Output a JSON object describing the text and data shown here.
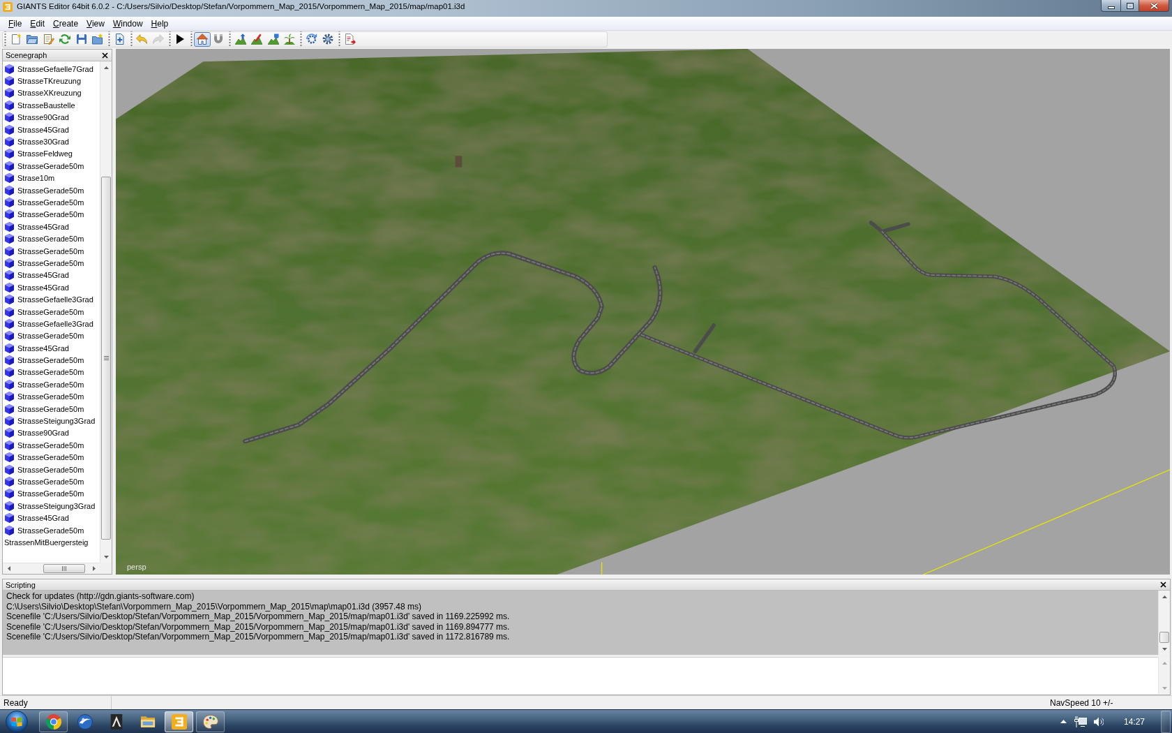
{
  "window": {
    "title": "GIANTS Editor 64bit 6.0.2 - C:/Users/Silvio/Desktop/Stefan/Vorpommern_Map_2015/Vorpommern_Map_2015/map/map01.i3d"
  },
  "menu": [
    "File",
    "Edit",
    "Create",
    "View",
    "Window",
    "Help"
  ],
  "toolbar": {
    "groups": [
      {
        "items": [
          {
            "kind": "new",
            "selected": false,
            "disabled": false
          },
          {
            "kind": "open",
            "selected": false,
            "disabled": false
          },
          {
            "kind": "edit",
            "selected": false,
            "disabled": false
          },
          {
            "kind": "reload",
            "selected": false,
            "disabled": false
          },
          {
            "kind": "save",
            "selected": false,
            "disabled": false
          },
          {
            "kind": "export",
            "selected": false,
            "disabled": false
          }
        ]
      },
      {
        "items": [
          {
            "kind": "import",
            "selected": false,
            "disabled": false
          }
        ]
      },
      {
        "items": [
          {
            "kind": "undo",
            "selected": false,
            "disabled": false
          },
          {
            "kind": "redo",
            "selected": false,
            "disabled": true
          }
        ]
      },
      {
        "items": [
          {
            "kind": "play",
            "selected": false,
            "disabled": false
          }
        ]
      },
      {
        "items": [
          {
            "kind": "home",
            "selected": true,
            "disabled": false
          },
          {
            "kind": "magnet",
            "selected": false,
            "disabled": false
          }
        ]
      },
      {
        "items": [
          {
            "kind": "terrain",
            "selected": false,
            "disabled": false
          },
          {
            "kind": "sculpt",
            "selected": false,
            "disabled": false
          },
          {
            "kind": "paint",
            "selected": false,
            "disabled": false
          },
          {
            "kind": "foliage",
            "selected": false,
            "disabled": false
          }
        ]
      },
      {
        "items": [
          {
            "kind": "sync",
            "selected": false,
            "disabled": false
          },
          {
            "kind": "settings",
            "selected": false,
            "disabled": false
          }
        ]
      },
      {
        "items": [
          {
            "kind": "report",
            "selected": false,
            "disabled": false
          }
        ]
      }
    ]
  },
  "scenegraph": {
    "title": "Scenegraph",
    "items": [
      {
        "label": "StrasseGefaelle7Grad",
        "kind": "shape",
        "selected": false
      },
      {
        "label": "StrasseTKreuzung",
        "kind": "shape",
        "selected": false
      },
      {
        "label": "StrasseXKreuzung",
        "kind": "shape",
        "selected": false
      },
      {
        "label": "StrasseBaustelle",
        "kind": "shape",
        "selected": false
      },
      {
        "label": "Strasse90Grad",
        "kind": "shape",
        "selected": false
      },
      {
        "label": "Strasse45Grad",
        "kind": "shape",
        "selected": false
      },
      {
        "label": "Strasse30Grad",
        "kind": "shape",
        "selected": false
      },
      {
        "label": "StrasseFeldweg",
        "kind": "shape",
        "selected": false
      },
      {
        "label": "StrasseGerade50m",
        "kind": "shape",
        "selected": false
      },
      {
        "label": "Strase10m",
        "kind": "shape",
        "selected": false
      },
      {
        "label": "StrasseGerade50m",
        "kind": "shape",
        "selected": false
      },
      {
        "label": "StrasseGerade50m",
        "kind": "shape",
        "selected": false
      },
      {
        "label": "StrasseGerade50m",
        "kind": "shape",
        "selected": false
      },
      {
        "label": "Strasse45Grad",
        "kind": "shape",
        "selected": false
      },
      {
        "label": "StrasseGerade50m",
        "kind": "shape",
        "selected": false
      },
      {
        "label": "StrasseGerade50m",
        "kind": "shape",
        "selected": false
      },
      {
        "label": "StrasseGerade50m",
        "kind": "shape",
        "selected": false
      },
      {
        "label": "Strasse45Grad",
        "kind": "shape",
        "selected": false
      },
      {
        "label": "Strasse45Grad",
        "kind": "shape",
        "selected": false
      },
      {
        "label": "StrasseGefaelle3Grad",
        "kind": "shape",
        "selected": false
      },
      {
        "label": "StrasseGerade50m",
        "kind": "shape",
        "selected": false
      },
      {
        "label": "StrasseGefaelle3Grad",
        "kind": "shape",
        "selected": false
      },
      {
        "label": "StrasseGerade50m",
        "kind": "shape",
        "selected": false
      },
      {
        "label": "Strasse45Grad",
        "kind": "shape",
        "selected": false
      },
      {
        "label": "StrasseGerade50m",
        "kind": "shape",
        "selected": false
      },
      {
        "label": "StrasseGerade50m",
        "kind": "shape",
        "selected": false
      },
      {
        "label": "StrasseGerade50m",
        "kind": "shape",
        "selected": false
      },
      {
        "label": "StrasseGerade50m",
        "kind": "shape",
        "selected": false
      },
      {
        "label": "StrasseGerade50m",
        "kind": "shape",
        "selected": false
      },
      {
        "label": "StrasseSteigung3Grad",
        "kind": "shape",
        "selected": false
      },
      {
        "label": "Strasse90Grad",
        "kind": "shape",
        "selected": false
      },
      {
        "label": "StrasseGerade50m",
        "kind": "shape",
        "selected": false
      },
      {
        "label": "StrasseGerade50m",
        "kind": "shape",
        "selected": false
      },
      {
        "label": "StrasseGerade50m",
        "kind": "shape",
        "selected": false
      },
      {
        "label": "StrasseGerade50m",
        "kind": "shape",
        "selected": false
      },
      {
        "label": "StrasseGerade50m",
        "kind": "shape",
        "selected": false
      },
      {
        "label": "StrasseSteigung3Grad",
        "kind": "shape",
        "selected": false
      },
      {
        "label": "Strasse45Grad",
        "kind": "shape",
        "selected": false
      },
      {
        "label": "StrasseGerade50m",
        "kind": "shape",
        "selected": false
      },
      {
        "label": "StrassenMitBuergersteig",
        "kind": "group",
        "selected": false
      }
    ]
  },
  "viewport": {
    "camera": "persp"
  },
  "scripting": {
    "title": "Scripting",
    "output": [
      "Check for updates (http://gdn.giants-software.com)",
      "C:\\Users\\Silvio\\Desktop\\Stefan\\Vorpommern_Map_2015\\Vorpommern_Map_2015\\map\\map01.i3d (3957.48 ms)",
      "Scenefile 'C:/Users/Silvio/Desktop/Stefan/Vorpommern_Map_2015/Vorpommern_Map_2015/map/map01.i3d' saved in 1169.225992 ms.",
      "Scenefile 'C:/Users/Silvio/Desktop/Stefan/Vorpommern_Map_2015/Vorpommern_Map_2015/map/map01.i3d' saved in 1169.894777 ms.",
      "Scenefile 'C:/Users/Silvio/Desktop/Stefan/Vorpommern_Map_2015/Vorpommern_Map_2015/map/map01.i3d' saved in 1172.816789 ms."
    ]
  },
  "status_bar": {
    "message": "Ready",
    "nav_speed": "NavSpeed 10 +/-"
  },
  "taskbar": {
    "buttons": [
      {
        "kind": "browser",
        "running": true,
        "selected": false
      },
      {
        "kind": "mail",
        "running": false,
        "selected": false
      },
      {
        "kind": "game",
        "running": false,
        "selected": false
      },
      {
        "kind": "folder",
        "running": false,
        "selected": false
      },
      {
        "kind": "editor",
        "running": true,
        "selected": true
      },
      {
        "kind": "paint",
        "running": true,
        "selected": false
      }
    ],
    "clock": "14:27"
  }
}
